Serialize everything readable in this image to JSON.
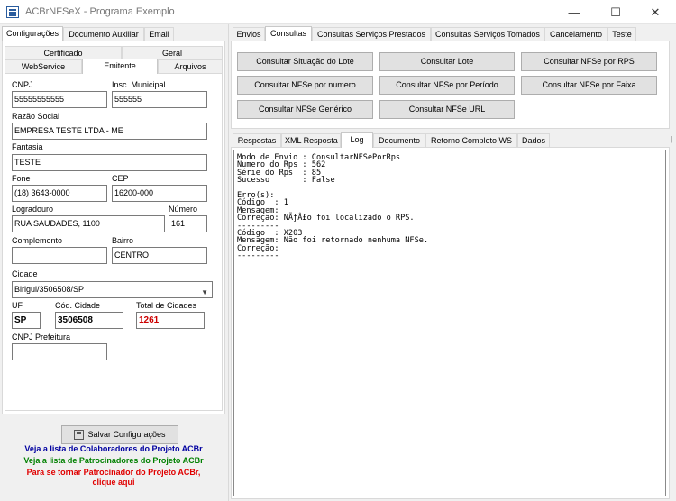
{
  "window": {
    "title": "ACBrNFSeX - Programa Exemplo",
    "minimize": "—",
    "maximize": "☐",
    "close": "✕"
  },
  "left_tabs": [
    "Configurações",
    "Documento Auxiliar",
    "Email"
  ],
  "sub_tabs_row1": [
    "Certificado",
    "Geral"
  ],
  "sub_tabs_row2": [
    "WebService",
    "Emitente",
    "Arquivos"
  ],
  "form": {
    "cnpj_label": "CNPJ",
    "cnpj": "55555555555",
    "im_label": "Insc. Municipal",
    "im": "555555",
    "razao_label": "Razão Social",
    "razao": "EMPRESA TESTE LTDA - ME",
    "fantasia_label": "Fantasia",
    "fantasia": "TESTE",
    "fone_label": "Fone",
    "fone": "(18) 3643-0000",
    "cep_label": "CEP",
    "cep": "16200-000",
    "logradouro_label": "Logradouro",
    "logradouro": "RUA SAUDADES, 1100",
    "numero_label": "Número",
    "numero": "161",
    "complemento_label": "Complemento",
    "complemento": "",
    "bairro_label": "Bairro",
    "bairro": "CENTRO",
    "cidade_label": "Cidade",
    "cidade": "Birigui/3506508/SP",
    "uf_label": "UF",
    "uf": "SP",
    "cod_cidade_label": "Cód. Cidade",
    "cod_cidade": "3506508",
    "total_cidades_label": "Total de Cidades",
    "total_cidades": "1261",
    "cnpj_prefeitura_label": "CNPJ Prefeitura",
    "cnpj_prefeitura": ""
  },
  "save_button": "Salvar Configurações",
  "footer": {
    "line1": "Veja a lista de Colaboradores do Projeto ACBr",
    "line2": "Veja a lista de Patrocinadores do Projeto ACBr",
    "line3": "Para se tornar Patrocinador do Projeto ACBr,",
    "line4": "clique aqui",
    "color1": "#0000a0",
    "color2": "#008000",
    "color3": "#e00000"
  },
  "right_tabs": [
    "Envios",
    "Consultas",
    "Consultas Serviços Prestados",
    "Consultas Serviços Tomados",
    "Cancelamento",
    "Teste"
  ],
  "buttons": [
    "Consultar Situação do Lote",
    "Consultar Lote",
    "Consultar NFSe por RPS",
    "Consultar NFSe por numero",
    "Consultar NFSe por Período",
    "Consultar NFSe por Faixa",
    "Consultar NFSe Genérico",
    "Consultar NFSe URL"
  ],
  "result_tabs": [
    "Respostas",
    "XML Resposta",
    "Log",
    "Documento",
    "Retorno Completo WS",
    "Dados"
  ],
  "log_lines": [
    "Modo de Envio : ConsultarNFSePorRps",
    "Numero do Rps : 562",
    "Série do Rps  : 85",
    "Sucesso       : False",
    "",
    "Erro(s):",
    "Código  : 1",
    "Mensagem:",
    "Correção: NÃƒÂ£o foi localizado o RPS.",
    "---------",
    "Código  : X203",
    "Mensagem: Não foi retornado nenhuma NFSe.",
    "Correção:",
    "---------"
  ]
}
